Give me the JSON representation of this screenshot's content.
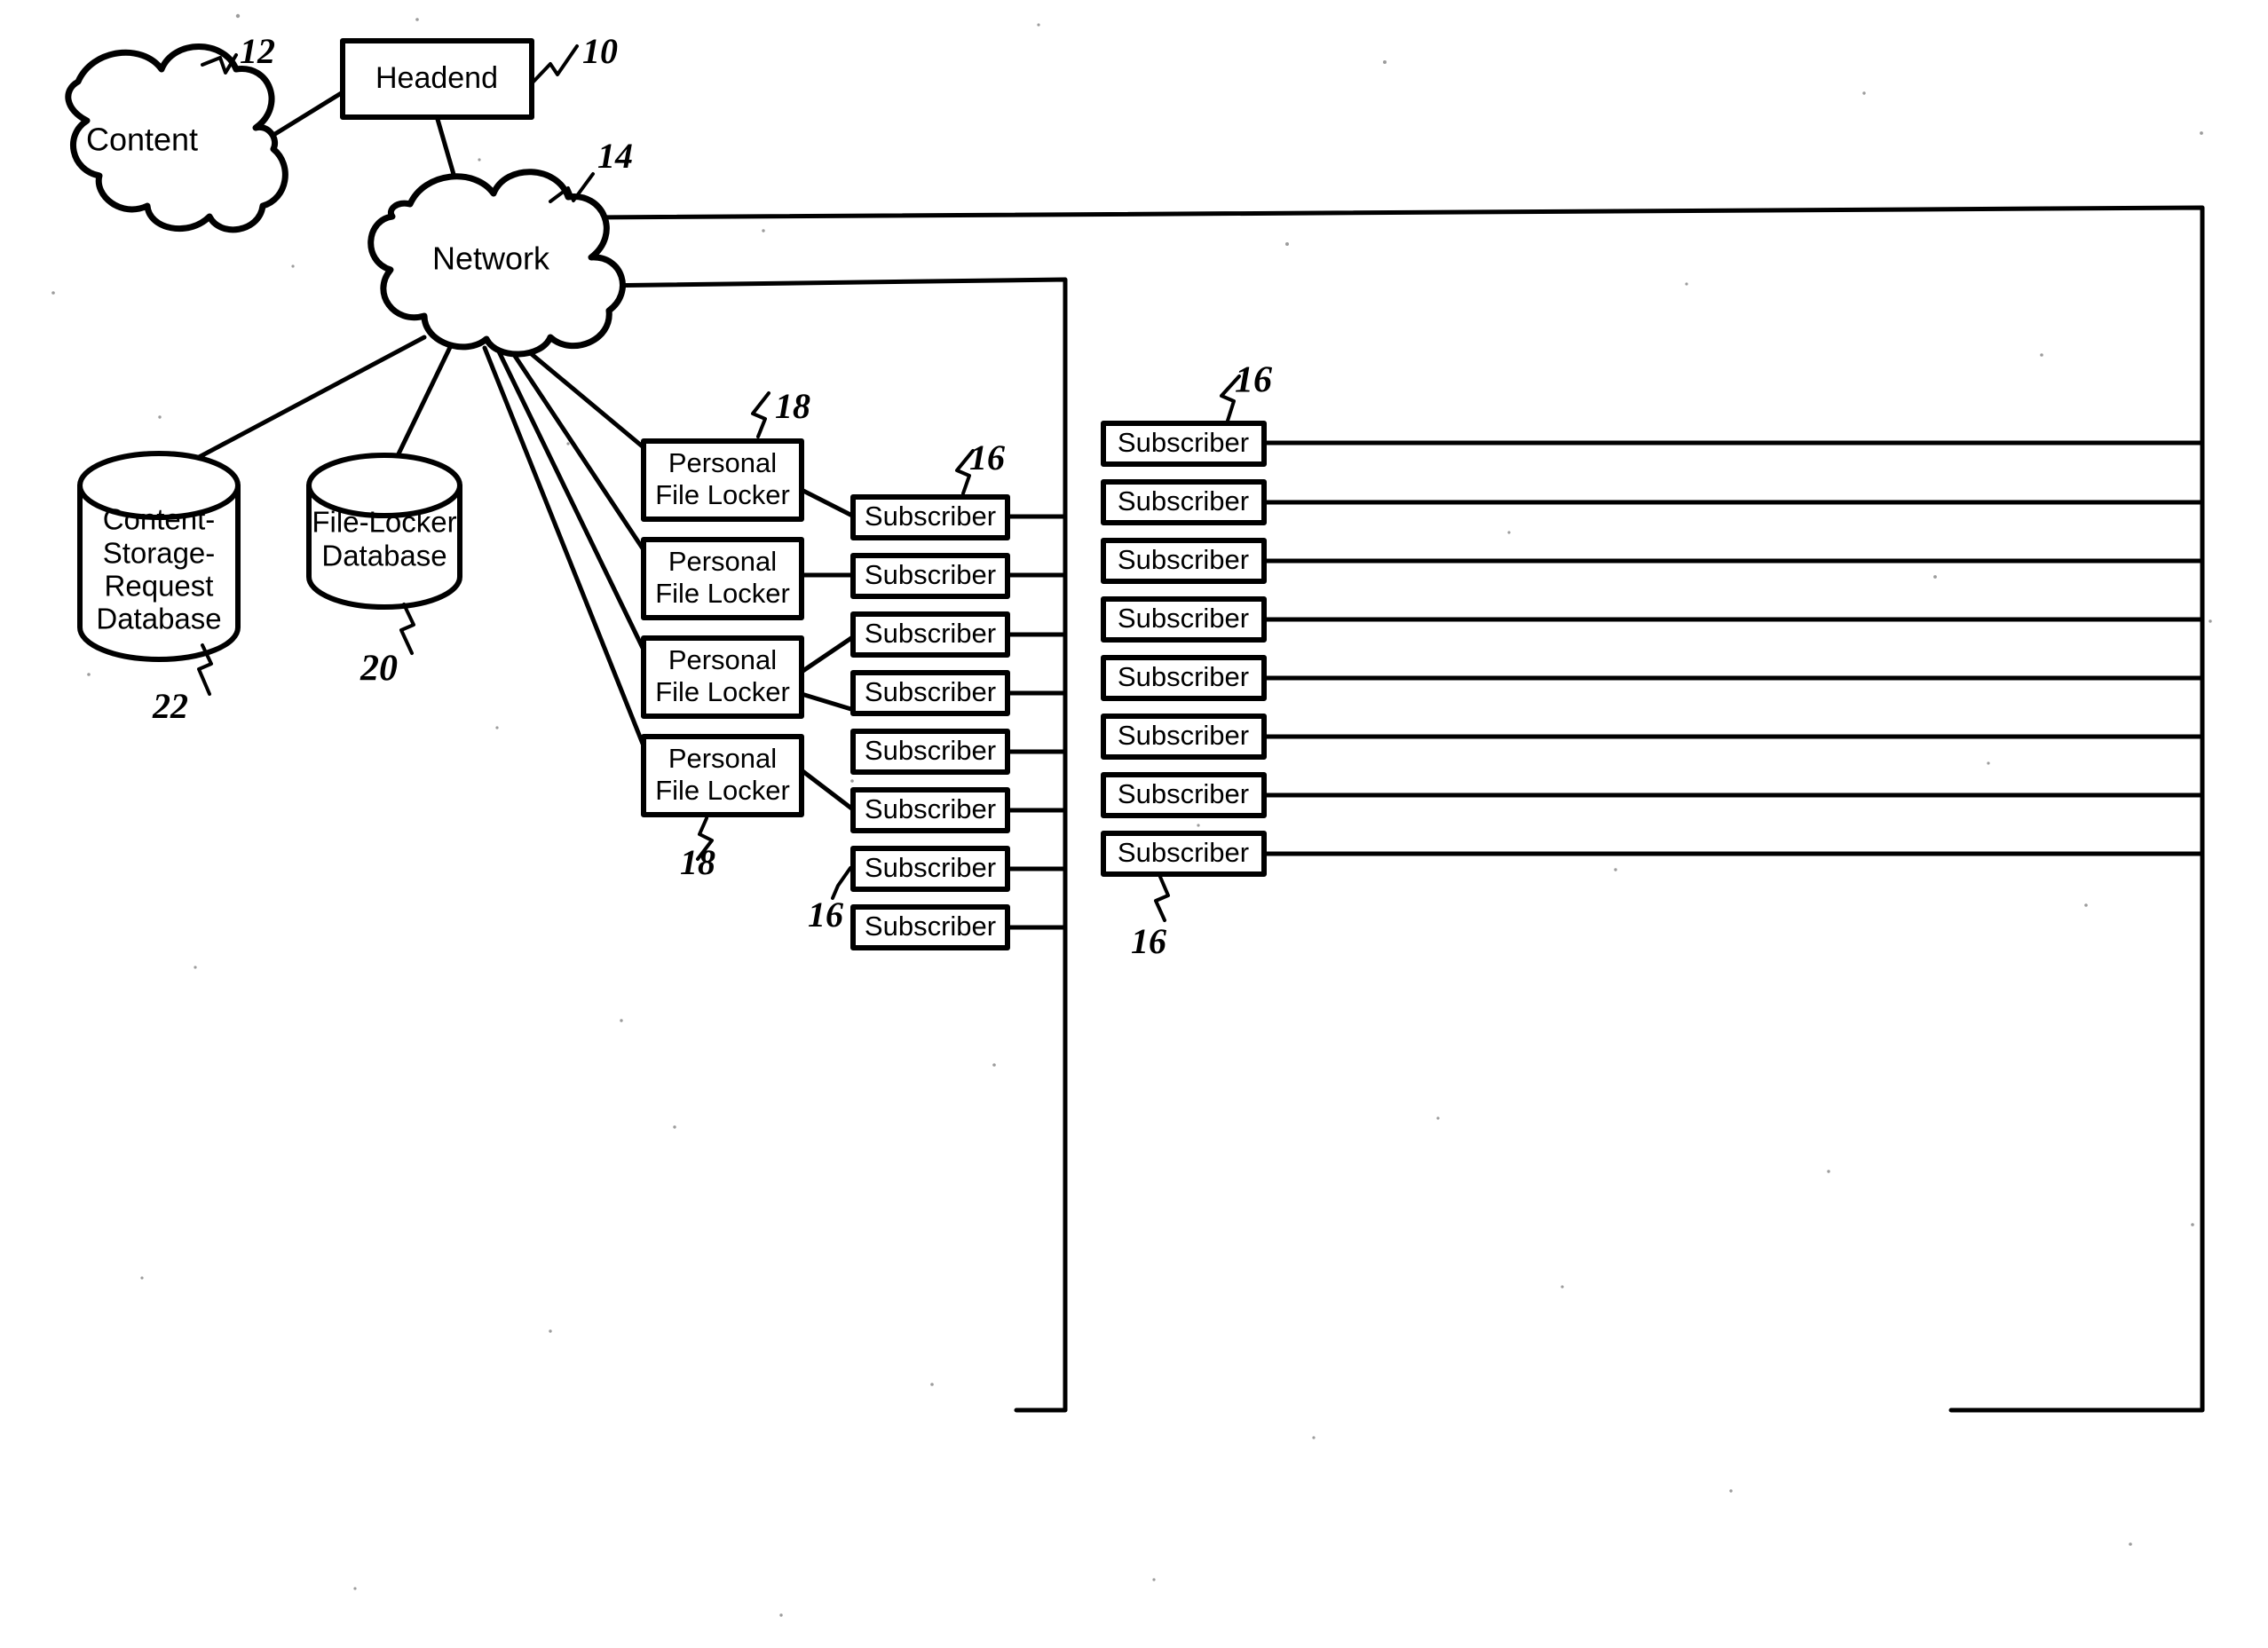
{
  "figure": {
    "kind": "patent-network-diagram",
    "background_color": "#ffffff",
    "line_color": "#000000"
  },
  "nodes": {
    "content_cloud": {
      "label": "Content",
      "ref": "12",
      "shape": "cloud"
    },
    "headend": {
      "label": "Headend",
      "ref": "10",
      "shape": "rect"
    },
    "network_cloud": {
      "label": "Network",
      "ref": "14",
      "shape": "cloud"
    },
    "content_storage_request_db": {
      "label_lines": [
        "Content-",
        "Storage-",
        "Request",
        "Database"
      ],
      "ref": "22",
      "shape": "cylinder"
    },
    "file_locker_db": {
      "label_lines": [
        "File-Locker",
        "Database"
      ],
      "ref": "20",
      "shape": "cylinder"
    }
  },
  "file_lockers": {
    "ref_top": "18",
    "ref_bottom": "18",
    "label_lines": [
      "Personal",
      "File Locker"
    ],
    "items": [
      {
        "label_lines": [
          "Personal",
          "File Locker"
        ]
      },
      {
        "label_lines": [
          "Personal",
          "File Locker"
        ]
      },
      {
        "label_lines": [
          "Personal",
          "File Locker"
        ]
      },
      {
        "label_lines": [
          "Personal",
          "File Locker"
        ]
      }
    ]
  },
  "subscribers_middle": {
    "ref_top": "16",
    "ref_bottom": "16",
    "items": [
      {
        "label": "Subscriber"
      },
      {
        "label": "Subscriber"
      },
      {
        "label": "Subscriber"
      },
      {
        "label": "Subscriber"
      },
      {
        "label": "Subscriber"
      },
      {
        "label": "Subscriber"
      },
      {
        "label": "Subscriber"
      },
      {
        "label": "Subscriber"
      }
    ]
  },
  "subscribers_right": {
    "ref_top": "16",
    "ref_bottom": "16",
    "items": [
      {
        "label": "Subscriber"
      },
      {
        "label": "Subscriber"
      },
      {
        "label": "Subscriber"
      },
      {
        "label": "Subscriber"
      },
      {
        "label": "Subscriber"
      },
      {
        "label": "Subscriber"
      },
      {
        "label": "Subscriber"
      },
      {
        "label": "Subscriber"
      }
    ]
  }
}
